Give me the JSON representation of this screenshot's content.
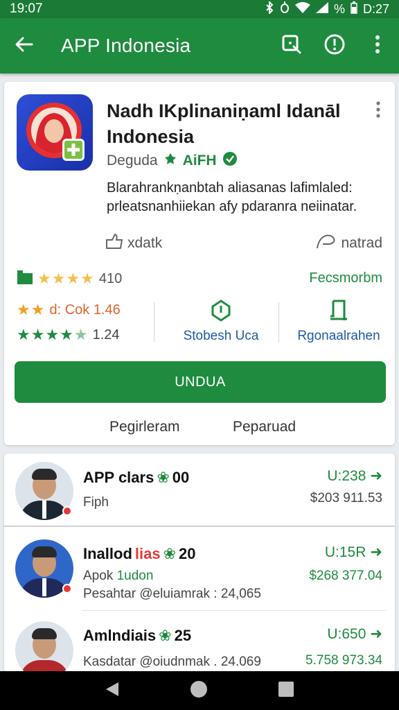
{
  "status": {
    "time": "19:07",
    "right_text": "%",
    "right_time": "D:27"
  },
  "appbar": {
    "title": "APP Indonesia",
    "back_icon": "arrow-left-icon",
    "search_icon": "search-icon",
    "info_icon": "alert-icon",
    "menu_icon": "more-vert-icon"
  },
  "app": {
    "title": "Nadh IKplinaniṇaml Idanāl Indonesia",
    "developer": "Deguda",
    "dev_tag": "AiFH",
    "description": "Blarahrankṇanbtah aliasanas lafimlaled: prleatsnanhiiekan afy pdaranra neiinatar.",
    "share_label": "xdatk",
    "wishlist_label": "natrad"
  },
  "ratings": {
    "row1_count": "410",
    "recommend_link": "Fecsmorbm",
    "row2_text": "d: Cok 1.46",
    "row3_value": "1.24",
    "stat1_label": "Stobesh Uca",
    "stat2_label": "Rgonaalrahen"
  },
  "install": {
    "label": "UNDUA"
  },
  "links": {
    "a": "Pegirleram",
    "b": "Peparuad"
  },
  "list": [
    {
      "title": "APP clars",
      "title_suffix": "00",
      "sub": "Fiph",
      "price": "U:238",
      "amount": "$203 911.53"
    },
    {
      "title": "Inallod",
      "title_hi": "lias",
      "title_suffix": "20",
      "sub1_a": "Apok",
      "sub1_b": "1udon",
      "sub2": "Pesahtar @eluiamrak : 24,065",
      "price": "U:15R",
      "amount": "$268 377.04"
    },
    {
      "title": "Amlndiais",
      "title_suffix": "25",
      "sub": "Kasdatar @oiudnmak . 24.069",
      "price": "U:650",
      "amount": "5.758 973.34"
    }
  ],
  "colors": {
    "primary": "#1e8b3e",
    "status_bar": "#1a7a36",
    "link_blue": "#1e5aa8",
    "accent_red": "#e53935",
    "star_gold": "#f4c04a"
  }
}
